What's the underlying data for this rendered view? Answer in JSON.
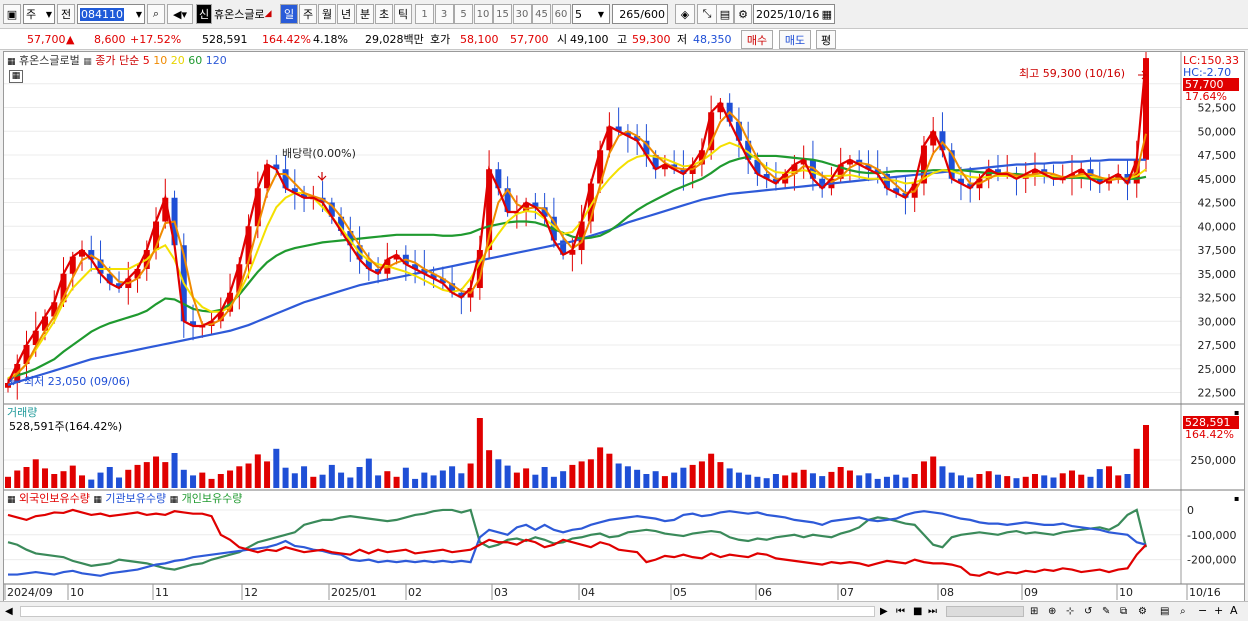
{
  "toolbar": {
    "period_short": "주",
    "prev_label": "전",
    "stock_code": "084110",
    "stock_name": "휴온스글로",
    "tag": "신",
    "periods": [
      "일",
      "주",
      "월",
      "년",
      "분",
      "초",
      "틱"
    ],
    "active_period": "일",
    "intervals": [
      "1",
      "3",
      "5",
      "10",
      "15",
      "30",
      "45",
      "60"
    ],
    "interval_value": "5",
    "count_value": "265",
    "count_total": "/600",
    "date_value": "2025/10/16"
  },
  "quote": {
    "price": "57,700",
    "arrow": "▲",
    "change": "8,600",
    "change_pct": "+17.52%",
    "volume": "528,591",
    "vol_ratio": "164.42%",
    "turnover": "4.18%",
    "amount": "29,028백만",
    "ask_label": "호가",
    "ask1": "58,100",
    "ask2": "57,700",
    "open_label": "시",
    "open": "49,100",
    "high_label": "고",
    "high": "59,300",
    "low_label": "저",
    "low": "48,350",
    "buy_label": "매수",
    "sell_label": "매도",
    "avg_label": "평"
  },
  "price_panel": {
    "name": "휴온스글로벌",
    "ma_title": "종가 단순",
    "ma_periods": [
      "5",
      "10",
      "20",
      "60",
      "120"
    ],
    "lc_label": "LC:150.33",
    "hc_label": "HC:-2.70",
    "price_tag": "57,700",
    "pct_tag": "17.64%",
    "high_note": "최고 59,300 (10/16)",
    "low_note": "최저 23,050 (09/06)",
    "dividend_note": "배당락(0.00%)",
    "y_ticks": [
      "55,000",
      "52,500",
      "50,000",
      "47,500",
      "45,000",
      "42,500",
      "40,000",
      "37,500",
      "35,000",
      "32,500",
      "30,000",
      "27,500",
      "25,000",
      "22,500"
    ]
  },
  "volume_panel": {
    "title": "거래량",
    "value_note": "528,591주(164.42%)",
    "tag": "528,591",
    "tag_pct": "164.42%",
    "y_ticks": [
      "250,000"
    ]
  },
  "holding_panel": {
    "series": [
      "외국인보유수량",
      "기관보유수량",
      "개인보유수량"
    ],
    "y_ticks": [
      "0",
      "-100,000",
      "-200,000"
    ]
  },
  "x_axis": {
    "labels": [
      "2024/09",
      "10",
      "11",
      "12",
      "2025/01",
      "02",
      "03",
      "04",
      "05",
      "06",
      "07",
      "08",
      "09",
      "10",
      "10/16"
    ]
  },
  "colors": {
    "up": "#e00000",
    "down": "#1f4fd6",
    "ma5": "#e00000",
    "ma10": "#f08a00",
    "ma20": "#f4e000",
    "ma60": "#1f9a2f",
    "ma120": "#2e5ad8"
  },
  "chart_data": {
    "type": "line",
    "x_range": [
      "2024/09",
      "2025/10/16"
    ],
    "ylim": [
      21500,
      57500
    ],
    "price_close": [
      23500,
      25500,
      27500,
      29000,
      30500,
      32000,
      35000,
      36800,
      37500,
      36500,
      35000,
      34000,
      33500,
      34500,
      35500,
      37500,
      40500,
      43000,
      38000,
      30000,
      29500,
      29500,
      30000,
      31000,
      33000,
      36000,
      40000,
      44000,
      46500,
      46000,
      44000,
      43500,
      43000,
      43000,
      42500,
      41000,
      39500,
      38000,
      36500,
      35500,
      35000,
      36500,
      37000,
      36000,
      35500,
      35000,
      34500,
      34000,
      33000,
      32500,
      33500,
      37500,
      46000,
      44000,
      41500,
      41500,
      42500,
      42000,
      41000,
      38500,
      37000,
      37500,
      40500,
      44500,
      48000,
      50500,
      50000,
      49500,
      49000,
      47500,
      46000,
      46500,
      46000,
      45500,
      46500,
      48000,
      52000,
      53000,
      51000,
      49000,
      47000,
      45500,
      45000,
      44500,
      45500,
      46500,
      47000,
      45000,
      44000,
      45000,
      46500,
      47000,
      46500,
      46000,
      45500,
      44000,
      43500,
      43000,
      44500,
      48500,
      50000,
      48000,
      45000,
      44500,
      44000,
      45000,
      46000,
      45500,
      45500,
      45000,
      45500,
      46000,
      45500,
      45000,
      45000,
      45500,
      46000,
      45000,
      44500,
      45000,
      45500,
      44500,
      47000,
      57700
    ],
    "ma20": [
      24000,
      24500,
      25500,
      27000,
      28500,
      30000,
      32000,
      33500,
      34500,
      35500,
      35500,
      35500,
      35500,
      35500,
      36000,
      36500,
      37500,
      38000,
      36500,
      34000,
      32500,
      31500,
      31000,
      31000,
      31500,
      33000,
      35000,
      37500,
      40000,
      42000,
      43000,
      43500,
      43500,
      43000,
      42000,
      41000,
      39800,
      38500,
      37200,
      36400,
      36000,
      35800,
      35500,
      35200,
      34800,
      34300,
      33800,
      33300,
      33100,
      33300,
      34500,
      36200,
      37800,
      39200,
      40500,
      41300,
      41600,
      41500,
      40800,
      40000,
      39200,
      39400,
      40500,
      42200,
      43800,
      45000,
      46000,
      46800,
      47300,
      47500,
      47300,
      47100,
      46700,
      46300,
      46400,
      46900,
      47600,
      48400,
      48800,
      48400,
      47800,
      47000,
      46200,
      45700,
      45600,
      45700,
      45900,
      45700,
      45300,
      45300,
      45300,
      45400,
      45200,
      45000,
      45000,
      44900,
      44800,
      44500,
      44600,
      45000,
      45600,
      45900,
      45800,
      45500,
      45200,
      45100,
      45200,
      45300,
      45300,
      45200,
      45200,
      45300,
      45300,
      45300,
      45200,
      45200,
      45300,
      45200,
      45100,
      45000,
      45000,
      45000,
      45300,
      46000
    ],
    "ma60": [
      24000,
      24300,
      24600,
      25000,
      25500,
      26000,
      26800,
      27500,
      28200,
      28900,
      29400,
      29800,
      30100,
      30400,
      30700,
      31100,
      31800,
      32400,
      32300,
      31800,
      31300,
      31100,
      31000,
      31200,
      31800,
      32800,
      34000,
      35200,
      36200,
      36900,
      37400,
      37700,
      37900,
      38100,
      38300,
      38400,
      38500,
      38600,
      38700,
      38800,
      38900,
      39000,
      39100,
      39100,
      39100,
      39100,
      39100,
      39000,
      39000,
      39100,
      39300,
      39700,
      40000,
      40200,
      40400,
      40500,
      40500,
      40400,
      40100,
      39700,
      39300,
      38900,
      38700,
      38800,
      39000,
      39500,
      40200,
      41000,
      41700,
      42300,
      42800,
      43300,
      43800,
      44200,
      44600,
      45000,
      45600,
      46300,
      46800,
      47100,
      47300,
      47400,
      47400,
      47400,
      47300,
      47200,
      47100,
      47000,
      46800,
      46500,
      46200,
      45900,
      45700,
      45600,
      45600,
      45700,
      45800,
      45800,
      45800,
      45800,
      45900,
      45900,
      45900,
      45900,
      45800,
      45700,
      45600,
      45600,
      45500,
      45500,
      45400,
      45300,
      45300,
      45200,
      45100,
      45100,
      45100,
      45000,
      45000,
      45000,
      45000,
      45000,
      45000,
      45200
    ],
    "ma120": [
      23300,
      23600,
      23900,
      24200,
      24500,
      24800,
      25100,
      25400,
      25700,
      26000,
      26200,
      26400,
      26600,
      26800,
      27000,
      27200,
      27400,
      27600,
      27800,
      28000,
      28200,
      28400,
      28600,
      28800,
      29000,
      29300,
      29600,
      30000,
      30400,
      30800,
      31200,
      31600,
      32000,
      32300,
      32600,
      32900,
      33200,
      33500,
      33800,
      34000,
      34200,
      34400,
      34600,
      34800,
      35000,
      35200,
      35400,
      35600,
      35800,
      36000,
      36200,
      36400,
      36600,
      36800,
      37000,
      37200,
      37400,
      37600,
      37800,
      38000,
      38200,
      38400,
      38700,
      39000,
      39300,
      39600,
      40000,
      40400,
      40700,
      41000,
      41300,
      41600,
      41900,
      42200,
      42500,
      42800,
      43000,
      43200,
      43400,
      43500,
      43600,
      43700,
      43800,
      43900,
      44000,
      44100,
      44200,
      44300,
      44400,
      44500,
      44600,
      44700,
      44800,
      44900,
      45000,
      45100,
      45200,
      45300,
      45400,
      45500,
      45600,
      45700,
      45800,
      45900,
      46000,
      46100,
      46200,
      46300,
      46400,
      46500,
      46500,
      46600,
      46600,
      46700,
      46700,
      46800,
      46800,
      46900,
      46900,
      47000,
      47000,
      47000,
      47000,
      47000
    ],
    "volume_levels": [
      0.16,
      0.25,
      0.3,
      0.41,
      0.28,
      0.2,
      0.24,
      0.32,
      0.18,
      0.12,
      0.22,
      0.3,
      0.15,
      0.26,
      0.33,
      0.37,
      0.45,
      0.37,
      0.5,
      0.26,
      0.18,
      0.22,
      0.13,
      0.2,
      0.25,
      0.31,
      0.35,
      0.48,
      0.38,
      0.56,
      0.29,
      0.21,
      0.31,
      0.16,
      0.19,
      0.33,
      0.22,
      0.15,
      0.3,
      0.42,
      0.18,
      0.24,
      0.16,
      0.29,
      0.13,
      0.22,
      0.18,
      0.25,
      0.31,
      0.21,
      0.35,
      1.0,
      0.54,
      0.41,
      0.32,
      0.22,
      0.28,
      0.19,
      0.3,
      0.16,
      0.24,
      0.33,
      0.38,
      0.41,
      0.58,
      0.49,
      0.35,
      0.31,
      0.26,
      0.2,
      0.24,
      0.17,
      0.22,
      0.29,
      0.33,
      0.38,
      0.49,
      0.37,
      0.28,
      0.22,
      0.19,
      0.16,
      0.14,
      0.2,
      0.18,
      0.22,
      0.26,
      0.21,
      0.17,
      0.23,
      0.3,
      0.25,
      0.18,
      0.21,
      0.13,
      0.16,
      0.19,
      0.15,
      0.2,
      0.38,
      0.45,
      0.31,
      0.22,
      0.18,
      0.15,
      0.2,
      0.24,
      0.19,
      0.17,
      0.14,
      0.16,
      0.2,
      0.18,
      0.15,
      0.21,
      0.25,
      0.19,
      0.16,
      0.27,
      0.31,
      0.18,
      0.2,
      0.56,
      0.9
    ],
    "foreign_holding": [
      -20000,
      -30000,
      -40000,
      -25000,
      -20000,
      -10000,
      -12000,
      0,
      -10000,
      -20000,
      -15000,
      -25000,
      -20000,
      -15000,
      -10000,
      -20000,
      -15000,
      -20000,
      -5000,
      -10000,
      -15000,
      -15000,
      -25000,
      -100000,
      -120000,
      -150000,
      -160000,
      -170000,
      -160000,
      -165000,
      -150000,
      -160000,
      -170000,
      -165000,
      -160000,
      -170000,
      -175000,
      -180000,
      -160000,
      -175000,
      -160000,
      -170000,
      -165000,
      -160000,
      -175000,
      -170000,
      -165000,
      -160000,
      -170000,
      -165000,
      -160000,
      -140000,
      -120000,
      -130000,
      -130000,
      -140000,
      -120000,
      -130000,
      -150000,
      -140000,
      -120000,
      -130000,
      -140000,
      -150000,
      -130000,
      -140000,
      -160000,
      -165000,
      -170000,
      -210000,
      -200000,
      -185000,
      -190000,
      -180000,
      -190000,
      -195000,
      -175000,
      -190000,
      -180000,
      -185000,
      -190000,
      -175000,
      -180000,
      -195000,
      -200000,
      -205000,
      -210000,
      -215000,
      -220000,
      -210000,
      -215000,
      -210000,
      -215000,
      -225000,
      -215000,
      -205000,
      -210000,
      -215000,
      -200000,
      -210000,
      -215000,
      -215000,
      -220000,
      -230000,
      -260000,
      -265000,
      -250000,
      -260000,
      -250000,
      -255000,
      -245000,
      -250000,
      -240000,
      -245000,
      -235000,
      -240000,
      -250000,
      -245000,
      -240000,
      -250000,
      -240000,
      -235000,
      -180000,
      -140000
    ],
    "institution_holding": [
      -260000,
      -260000,
      -255000,
      -250000,
      -255000,
      -260000,
      -250000,
      -245000,
      -255000,
      -260000,
      -265000,
      -255000,
      -250000,
      -245000,
      -240000,
      -230000,
      -220000,
      -215000,
      -205000,
      -200000,
      -190000,
      -185000,
      -180000,
      -175000,
      -170000,
      -165000,
      -160000,
      -155000,
      -150000,
      -140000,
      -125000,
      -145000,
      -150000,
      -160000,
      -165000,
      -175000,
      -180000,
      -200000,
      -205000,
      -200000,
      -210000,
      -205000,
      -210000,
      -205000,
      -210000,
      -205000,
      -210000,
      -205000,
      -210000,
      -205000,
      -210000,
      -110000,
      -80000,
      -90000,
      -100000,
      -70000,
      -60000,
      -80000,
      -60000,
      -80000,
      -90000,
      -80000,
      -75000,
      -60000,
      -50000,
      -40000,
      -35000,
      -30000,
      -25000,
      -30000,
      -35000,
      -45000,
      -40000,
      -20000,
      -15000,
      -25000,
      -20000,
      -10000,
      -5000,
      -10000,
      -15000,
      -10000,
      -20000,
      -25000,
      -30000,
      -40000,
      -45000,
      -50000,
      -60000,
      -45000,
      -40000,
      -35000,
      -30000,
      -40000,
      -45000,
      -40000,
      -35000,
      -20000,
      -10000,
      -5000,
      -10000,
      -15000,
      -25000,
      -35000,
      -40000,
      -50000,
      -55000,
      -55000,
      -60000,
      -55000,
      -50000,
      -55000,
      -60000,
      -60000,
      -55000,
      -65000,
      -70000,
      -75000,
      -80000,
      -90000,
      -95000,
      -100000,
      -130000,
      -140000
    ],
    "individual_holding": [
      -130000,
      -140000,
      -160000,
      -175000,
      -180000,
      -185000,
      -190000,
      -205000,
      -215000,
      -225000,
      -220000,
      -215000,
      -200000,
      -205000,
      -210000,
      -215000,
      -225000,
      -235000,
      -240000,
      -230000,
      -220000,
      -215000,
      -200000,
      -190000,
      -180000,
      -170000,
      -150000,
      -130000,
      -120000,
      -110000,
      -100000,
      -90000,
      -60000,
      -50000,
      -40000,
      -40000,
      -30000,
      -25000,
      -30000,
      -35000,
      -40000,
      -45000,
      -40000,
      -30000,
      -20000,
      -15000,
      -5000,
      0,
      0,
      -10000,
      0,
      -130000,
      -150000,
      -140000,
      -120000,
      -115000,
      -125000,
      -110000,
      -120000,
      -135000,
      -130000,
      -115000,
      -110000,
      -100000,
      -95000,
      -110000,
      -105000,
      -90000,
      -85000,
      -80000,
      -85000,
      -95000,
      -100000,
      -105000,
      -95000,
      -90000,
      -85000,
      -90000,
      -110000,
      -120000,
      -125000,
      -115000,
      -120000,
      -110000,
      -105000,
      -100000,
      -110000,
      -100000,
      -105000,
      -110000,
      -95000,
      -85000,
      -70000,
      -40000,
      -30000,
      -35000,
      -45000,
      -55000,
      -60000,
      -100000,
      -140000,
      -150000,
      -110000,
      -100000,
      -95000,
      -90000,
      -95000,
      -100000,
      -90000,
      -85000,
      -95000,
      -90000,
      -95000,
      -100000,
      -90000,
      -85000,
      -80000,
      -75000,
      -70000,
      -80000,
      -60000,
      -20000,
      0,
      -150000
    ]
  }
}
